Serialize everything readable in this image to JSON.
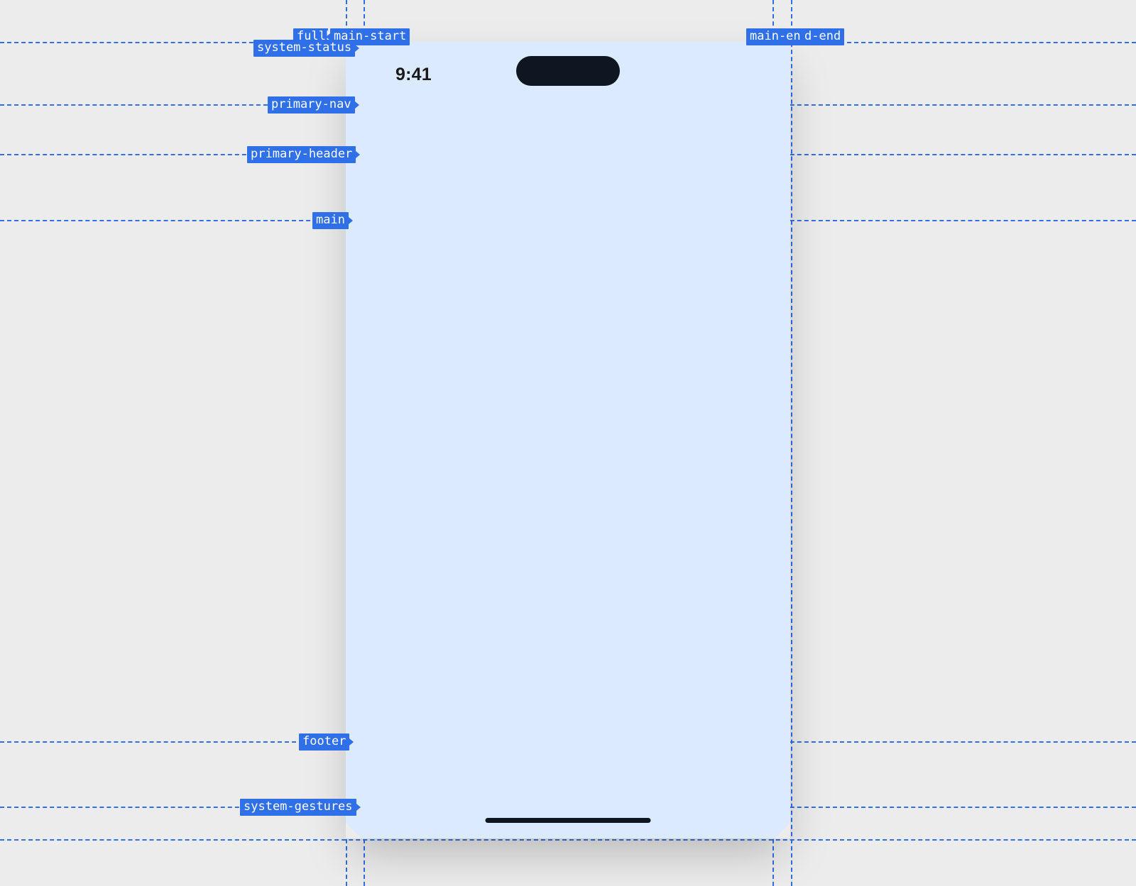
{
  "device": {
    "status_time": "9:41"
  },
  "guides": {
    "vertical": {
      "fullbleed_start": "fullbleed-start",
      "main_start": "main-start",
      "main_end": "main-end",
      "fullbleed_end": "fullbleed-end"
    },
    "horizontal": {
      "system_status": "system-status",
      "primary_nav": "primary-nav",
      "primary_header": "primary-header",
      "main": "main",
      "footer": "footer",
      "system_gestures": "system-gestures"
    }
  }
}
